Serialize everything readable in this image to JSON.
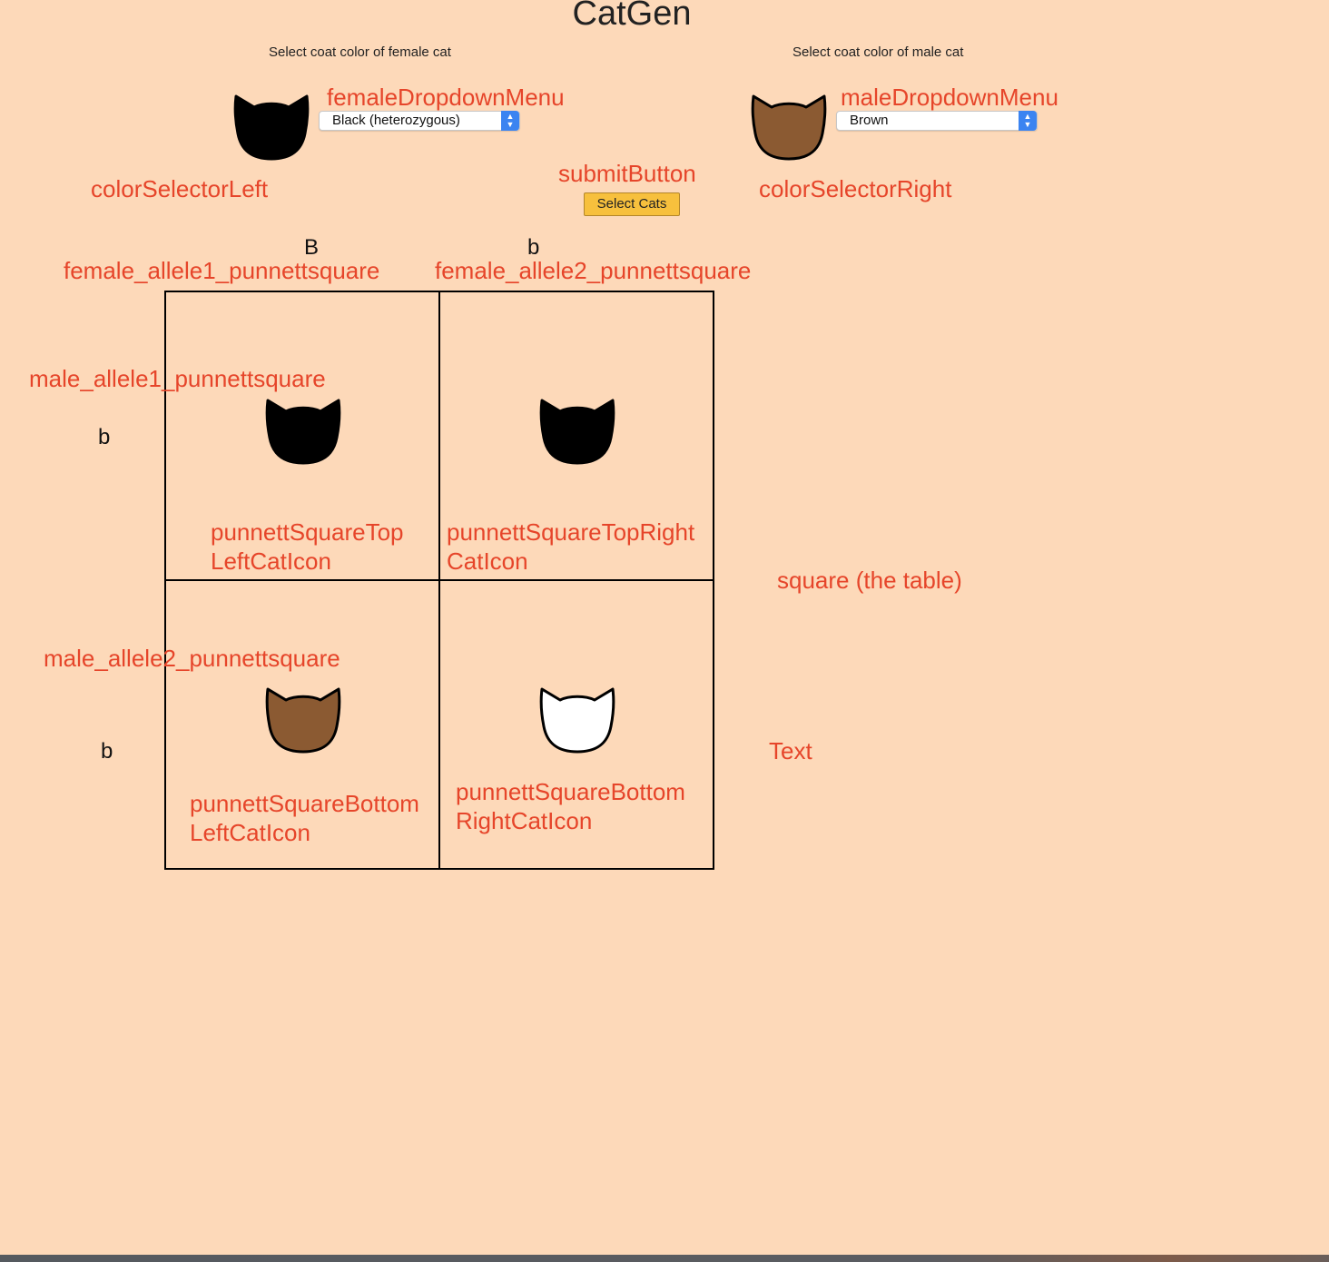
{
  "app": {
    "title": "CatGen"
  },
  "left": {
    "prompt": "Select coat color of female cat",
    "selected": "Black (heterozygous)",
    "cat_color": "#000000",
    "dropdown_annotation": "femaleDropdownMenu",
    "selector_annotation": "colorSelectorLeft"
  },
  "right": {
    "prompt": "Select coat color of male cat",
    "selected": "Brown",
    "cat_color": "#8b5a32",
    "dropdown_annotation": "maleDropdownMenu",
    "selector_annotation": "colorSelectorRight"
  },
  "submit": {
    "label": "Select Cats",
    "annotation": "submitButton"
  },
  "alleles": {
    "female1": "B",
    "female2": "b",
    "male1": "b",
    "male2": "b",
    "female1_annotation": "female_allele1_punnettsquare",
    "female2_annotation": "female_allele2_punnettsquare",
    "male1_annotation": "male_allele1_punnettsquare",
    "male2_annotation": "male_allele2_punnettsquare"
  },
  "square": {
    "annotation": "square (the table)",
    "text_annotation": "Text",
    "cells": {
      "top_left": {
        "color": "#000000",
        "annotation_line1": "punnettSquareTop",
        "annotation_line2": "LeftCatIcon"
      },
      "top_right": {
        "color": "#000000",
        "annotation_line1": "punnettSquareTopRight",
        "annotation_line2": "CatIcon"
      },
      "bottom_left": {
        "color": "#8b5a32",
        "annotation_line1": "punnettSquareBottom",
        "annotation_line2": "LeftCatIcon"
      },
      "bottom_right": {
        "color": "#ffffff",
        "annotation_line1": "punnettSquareBottom",
        "annotation_line2": "RightCatIcon"
      }
    }
  },
  "colors": {
    "background": "#fdd9b9",
    "annotation": "#e6452a",
    "button": "#f7c03d"
  }
}
